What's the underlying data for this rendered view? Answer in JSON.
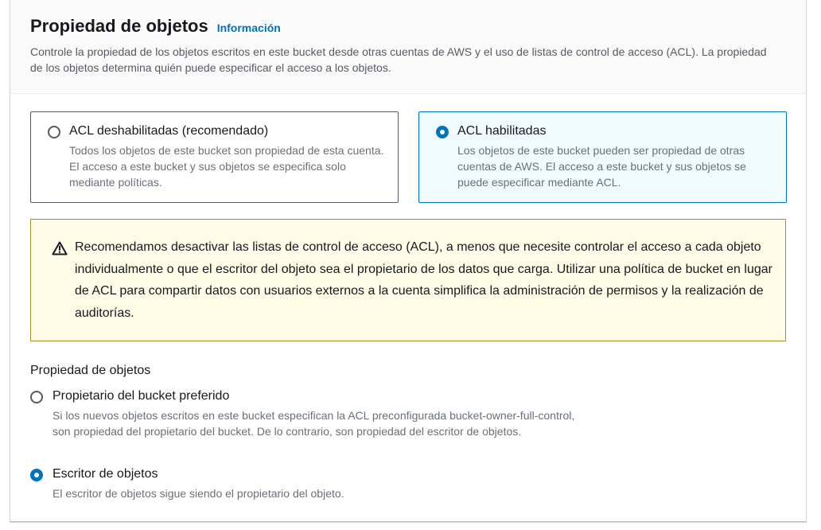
{
  "section": {
    "title": "Propiedad de objetos",
    "info_link": "Información",
    "description": "Controle la propiedad de los objetos escritos en este bucket desde otras cuentas de AWS y el uso de listas de control de acceso (ACL). La propiedad de los objetos determina quién puede especificar el acceso a los objetos."
  },
  "acl_tiles": [
    {
      "label": "ACL deshabilitadas (recomendado)",
      "description": "Todos los objetos de este bucket son propiedad de esta cuenta. El acceso a este bucket y sus objetos se especifica solo mediante políticas.",
      "selected": false
    },
    {
      "label": "ACL habilitadas",
      "description": "Los objetos de este bucket pueden ser propiedad de otras cuentas de AWS. El acceso a este bucket y sus objetos se puede especificar mediante ACL.",
      "selected": true
    }
  ],
  "warning": {
    "icon": "warning-triangle-icon",
    "text": "Recomendamos desactivar las listas de control de acceso (ACL), a menos que necesite controlar el acceso a cada objeto individualmente o que el escritor del objeto sea el propietario de los datos que carga. Utilizar una política de bucket en lugar de ACL para compartir datos con usuarios externos a la cuenta simplifica la administración de permisos y la realización de auditorías."
  },
  "ownership": {
    "label": "Propiedad de objetos",
    "options": [
      {
        "label": "Propietario del bucket preferido",
        "description": "Si los nuevos objetos escritos en este bucket especifican la ACL preconfigurada bucket-owner-full-control, son propiedad del propietario del bucket. De lo contrario, son propiedad del escritor de objetos.",
        "selected": false
      },
      {
        "label": "Escritor de objetos",
        "description": "El escritor de objetos sigue siendo el propietario del objeto.",
        "selected": true
      }
    ]
  },
  "colors": {
    "accent": "#0073bb",
    "selected_tile_bg": "#f1faff",
    "warning_bg": "#fffce7",
    "warning_border": "#aa8f2a",
    "secondary_text": "#687078"
  }
}
